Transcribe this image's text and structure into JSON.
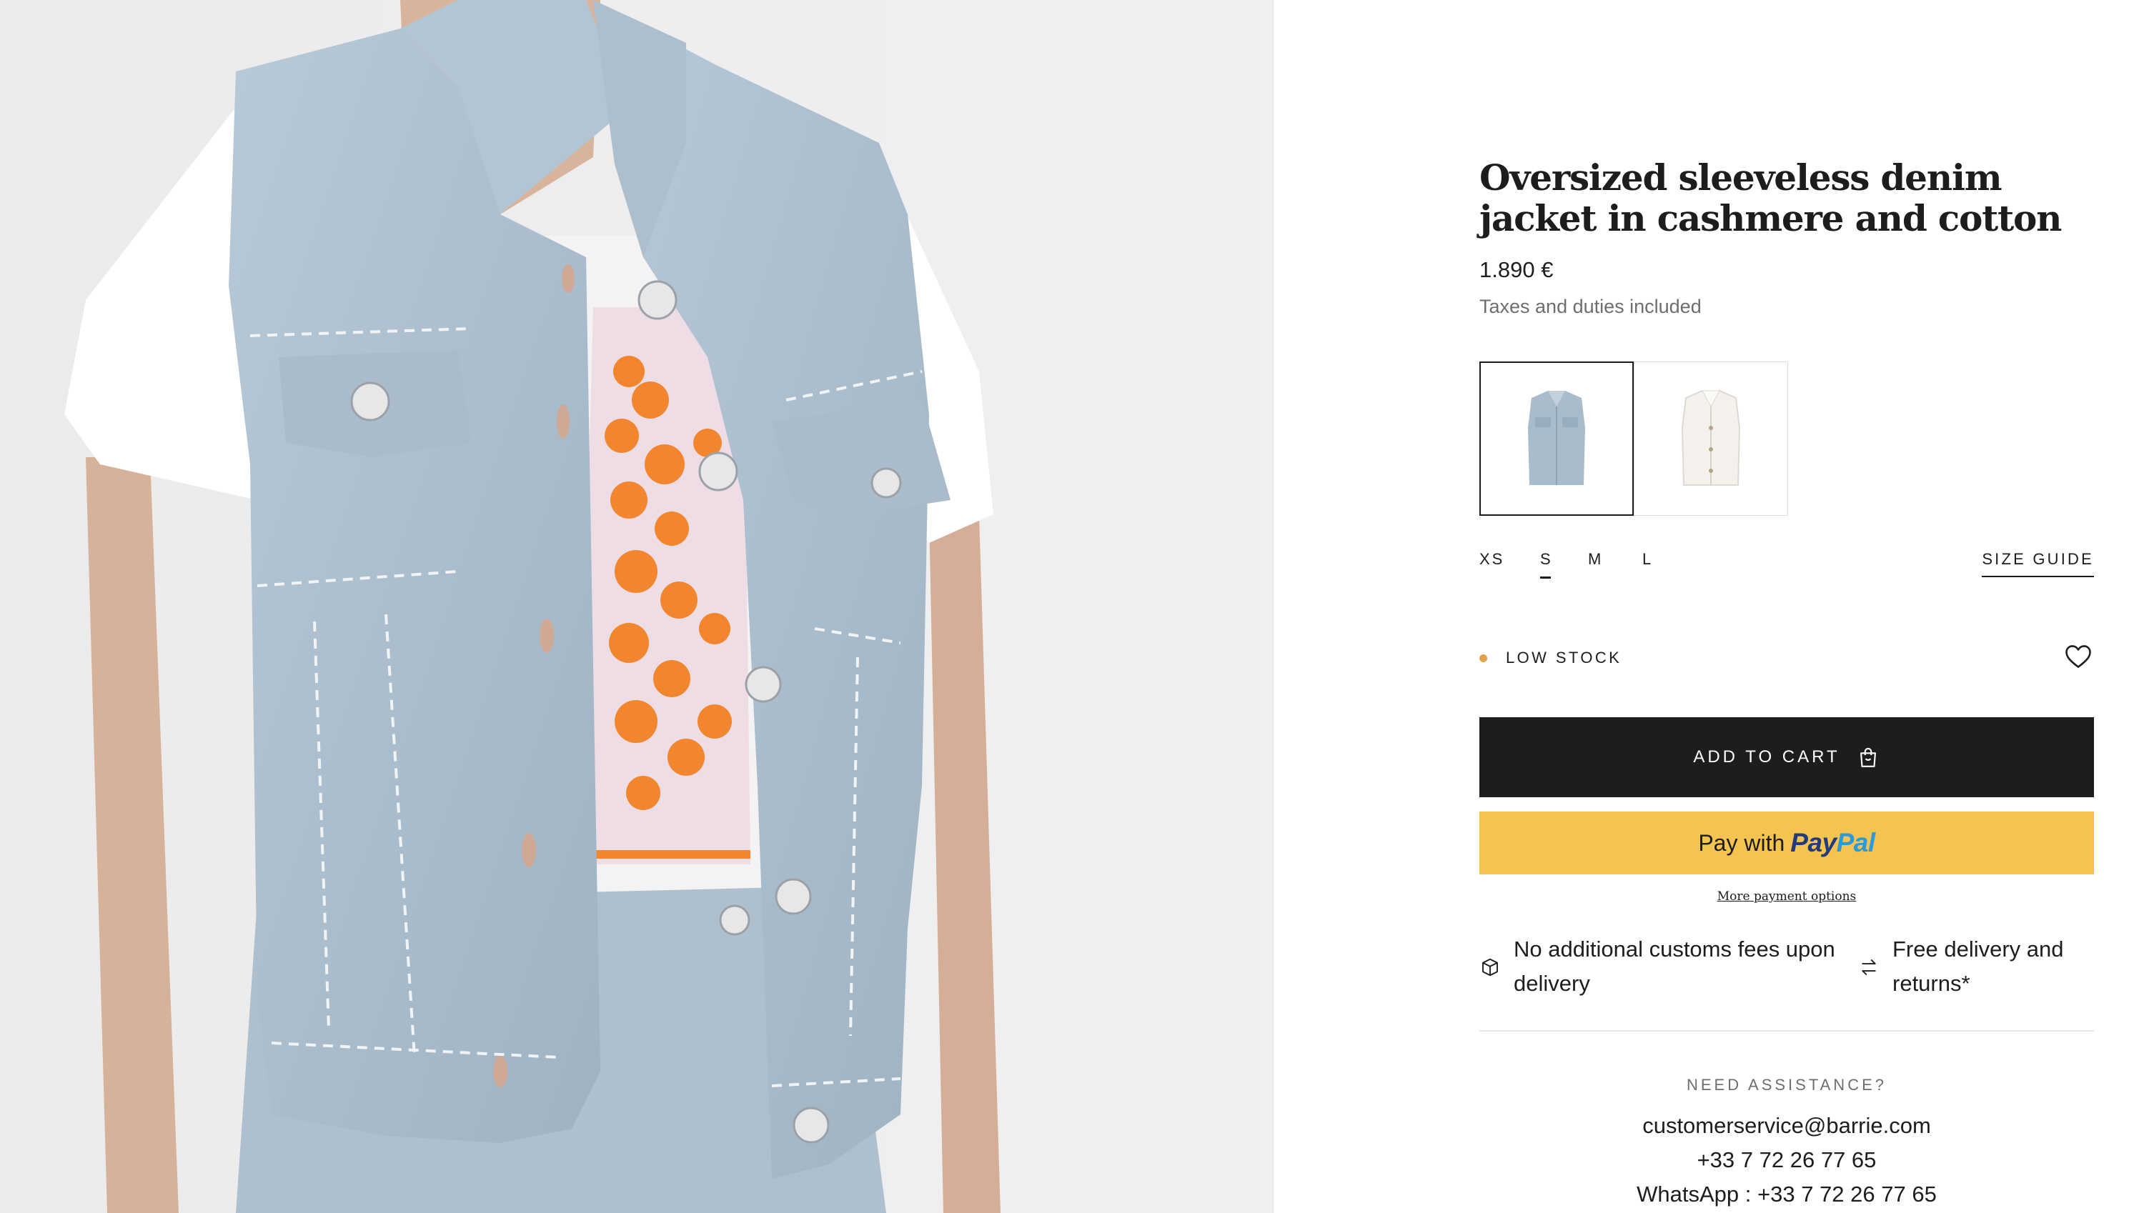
{
  "product": {
    "title": "Oversized sleeveless denim jacket in cashmere and cotton",
    "price": "1.890 €",
    "taxes_note": "Taxes and duties included",
    "colors": [
      {
        "name": "light blue",
        "hex": "#a9bccb",
        "selected": true
      },
      {
        "name": "white",
        "hex": "#f4f1ec",
        "selected": false
      }
    ]
  },
  "sizes": {
    "options": [
      "XS",
      "S",
      "M",
      "L"
    ],
    "selected": "S",
    "guide_label": "SIZE GUIDE"
  },
  "stock": {
    "label": "LOW STOCK",
    "color": "#e0a24a"
  },
  "actions": {
    "add_to_cart": "ADD TO CART",
    "paypal_prefix": "Pay with",
    "paypal_brand_1": "Pay",
    "paypal_brand_2": "Pal",
    "more_payment": "More payment options"
  },
  "features": [
    {
      "icon": "box-icon",
      "text_1": "No additional customs fees upon",
      "text_2": "delivery"
    },
    {
      "icon": "exchange-arrows-icon",
      "text_1": "Free delivery and",
      "text_2": "returns*"
    }
  ],
  "assistance": {
    "title": "NEED ASSISTANCE?",
    "email": "customerservice@barrie.com",
    "phone": "+33 7 72 26 77 65",
    "whatsapp": "WhatsApp : +33 7 72 26 77 65"
  },
  "colors": {
    "primary_button": "#1d1d1b",
    "paypal_yellow": "#f5c34f",
    "paypal_navy": "#233b7e",
    "paypal_blue": "#2a9bd8"
  }
}
